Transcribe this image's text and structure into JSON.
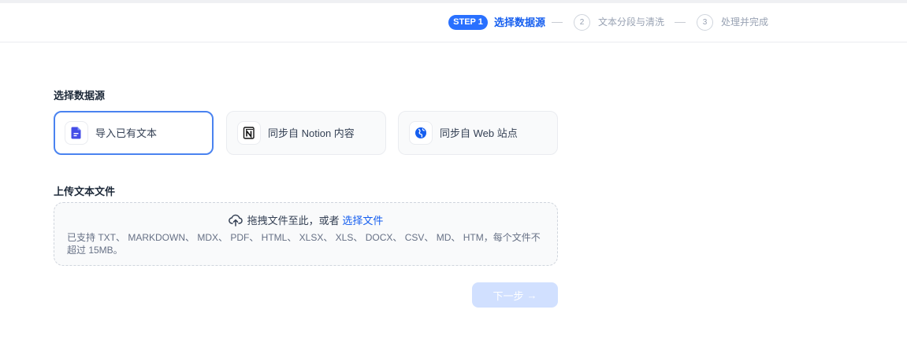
{
  "steps": {
    "step1_badge": "STEP 1",
    "step1_label": "选择数据源",
    "step2_num": "2",
    "step2_label": "文本分段与清洗",
    "step3_num": "3",
    "step3_label": "处理并完成"
  },
  "datasource": {
    "title": "选择数据源",
    "options": [
      {
        "label": "导入已有文本",
        "icon": "document-icon",
        "selected": true
      },
      {
        "label": "同步自 Notion 内容",
        "icon": "notion-icon",
        "selected": false
      },
      {
        "label": "同步自 Web 站点",
        "icon": "web-icon",
        "selected": false
      }
    ]
  },
  "upload": {
    "title": "上传文本文件",
    "drop_text": "拖拽文件至此，或者",
    "select_link": "选择文件",
    "hint": "已支持 TXT、 MARKDOWN、 MDX、 PDF、 HTML、 XLSX、 XLS、 DOCX、 CSV、 MD、 HTM，每个文件不超过 15MB。"
  },
  "footer": {
    "next_label": "下一步",
    "next_arrow": "→"
  },
  "colors": {
    "accent": "#155eef",
    "step_badge": "#2970ff",
    "next_disabled": "#d1e0ff"
  }
}
